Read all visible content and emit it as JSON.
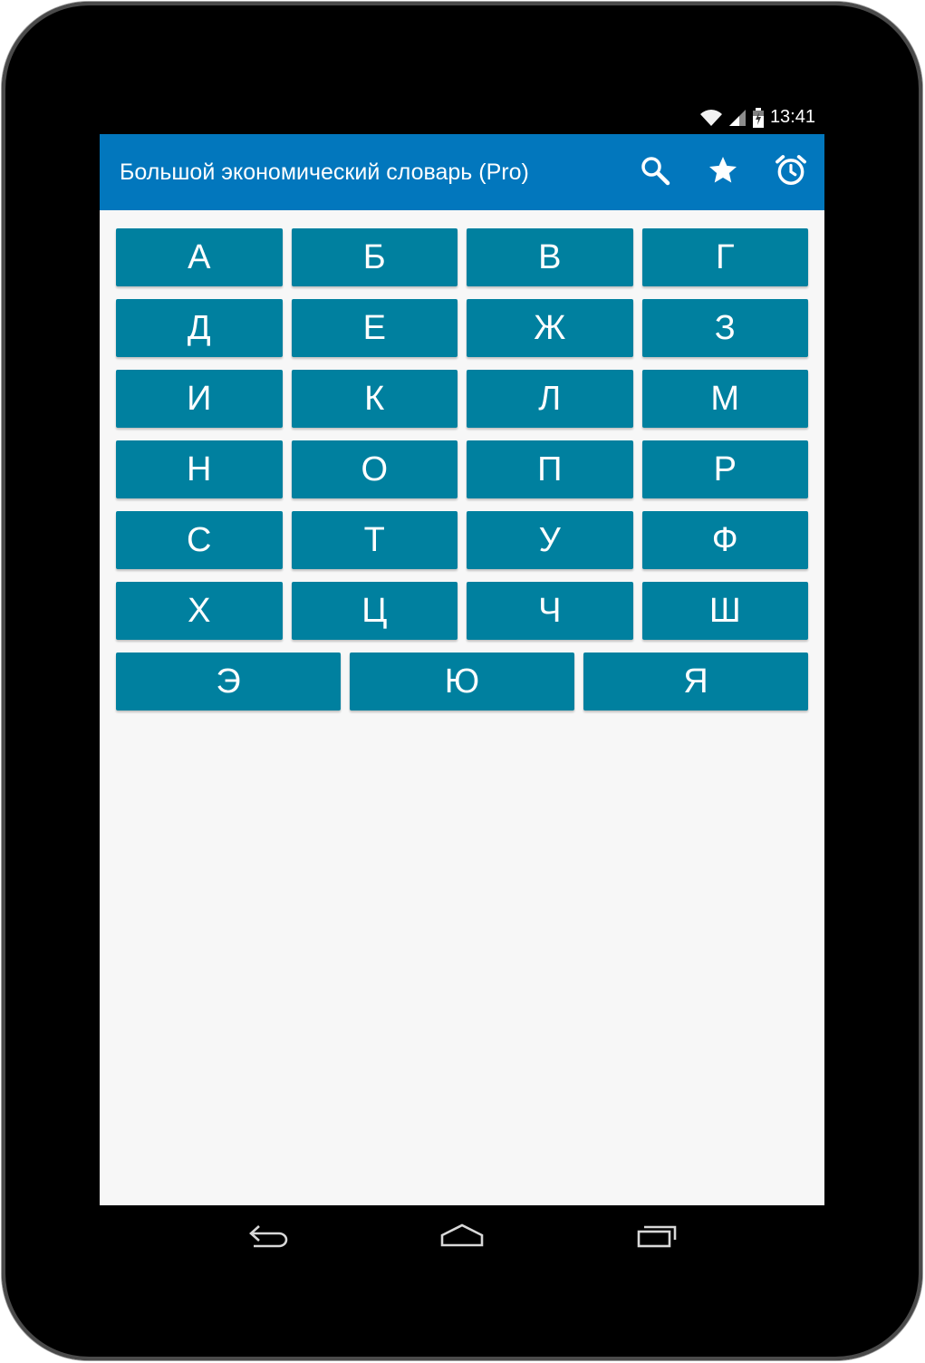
{
  "status": {
    "time": "13:41",
    "icons": [
      "wifi-icon",
      "signal-icon",
      "battery-icon"
    ]
  },
  "appbar": {
    "title": "Большой экономический словарь (Pro)",
    "actions": [
      "search-icon",
      "star-icon",
      "alarm-icon"
    ],
    "color": "#0277bd"
  },
  "letters": {
    "rows": [
      [
        "А",
        "Б",
        "В",
        "Г"
      ],
      [
        "Д",
        "Е",
        "Ж",
        "З"
      ],
      [
        "И",
        "К",
        "Л",
        "М"
      ],
      [
        "Н",
        "О",
        "П",
        "Р"
      ],
      [
        "С",
        "Т",
        "У",
        "Ф"
      ],
      [
        "Х",
        "Ц",
        "Ч",
        "Ш"
      ],
      [
        "Э",
        "Ю",
        "Я"
      ]
    ],
    "button_color": "#00809f"
  },
  "navbar": {
    "buttons": [
      "back-icon",
      "home-icon",
      "recents-icon"
    ]
  }
}
